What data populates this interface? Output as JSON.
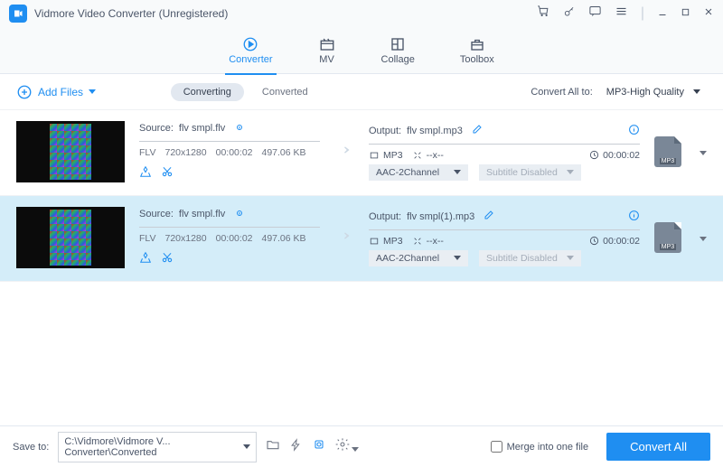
{
  "app": {
    "title": "Vidmore Video Converter (Unregistered)"
  },
  "tabs": {
    "converter": "Converter",
    "mv": "MV",
    "collage": "Collage",
    "toolbox": "Toolbox"
  },
  "toolbar": {
    "add_files": "Add Files",
    "converting": "Converting",
    "converted": "Converted",
    "convert_all_to": "Convert All to:",
    "format": "MP3-High Quality"
  },
  "items": [
    {
      "source_label": "Source:",
      "source_name": "flv smpl.flv",
      "format": "FLV",
      "resolution": "720x1280",
      "duration": "00:00:02",
      "size": "497.06 KB",
      "output_label": "Output:",
      "output_name": "flv smpl.mp3",
      "container": "MP3",
      "scale": "--x--",
      "out_duration": "00:00:02",
      "audio": "AAC-2Channel",
      "subtitle": "Subtitle Disabled",
      "badge": "MP3"
    },
    {
      "source_label": "Source:",
      "source_name": "flv smpl.flv",
      "format": "FLV",
      "resolution": "720x1280",
      "duration": "00:00:02",
      "size": "497.06 KB",
      "output_label": "Output:",
      "output_name": "flv smpl(1).mp3",
      "container": "MP3",
      "scale": "--x--",
      "out_duration": "00:00:02",
      "audio": "AAC-2Channel",
      "subtitle": "Subtitle Disabled",
      "badge": "MP3"
    }
  ],
  "footer": {
    "save_to": "Save to:",
    "path": "C:\\Vidmore\\Vidmore V... Converter\\Converted",
    "merge": "Merge into one file",
    "convert_all": "Convert All"
  }
}
